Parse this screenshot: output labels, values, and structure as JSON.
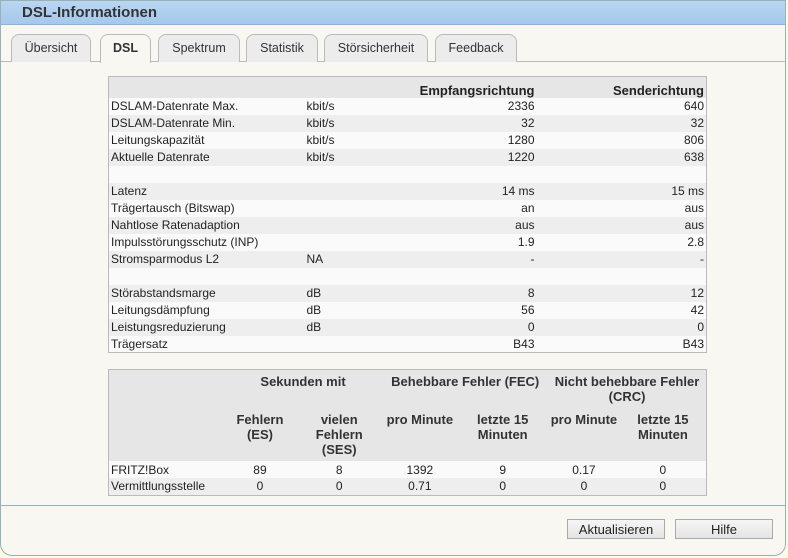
{
  "title": "DSL-Informationen",
  "tabs": [
    "Übersicht",
    "DSL",
    "Spektrum",
    "Statistik",
    "Störsicherheit",
    "Feedback"
  ],
  "info_table": {
    "headers": [
      "",
      "",
      "Empfangsrichtung",
      "Senderichtung"
    ],
    "rows": [
      [
        "DSLAM-Datenrate Max.",
        "kbit/s",
        "2336",
        "640"
      ],
      [
        "DSLAM-Datenrate Min.",
        "kbit/s",
        "32",
        "32"
      ],
      [
        "Leitungskapazität",
        "kbit/s",
        "1280",
        "806"
      ],
      [
        "Aktuelle Datenrate",
        "kbit/s",
        "1220",
        "638"
      ],
      [
        "",
        "",
        "",
        ""
      ],
      [
        "Latenz",
        "",
        "14 ms",
        "15 ms"
      ],
      [
        "Trägertausch (Bitswap)",
        "",
        "an",
        "aus"
      ],
      [
        "Nahtlose Ratenadaption",
        "",
        "aus",
        "aus"
      ],
      [
        "Impulsstörungsschutz (INP)",
        "",
        "1.9",
        "2.8"
      ],
      [
        "Stromsparmodus L2",
        "NA",
        "-",
        "-"
      ],
      [
        "",
        "",
        "",
        ""
      ],
      [
        "Störabstandsmarge",
        "dB",
        "8",
        "12"
      ],
      [
        "Leitungsdämpfung",
        "dB",
        "56",
        "42"
      ],
      [
        "Leistungsreduzierung",
        "dB",
        "0",
        "0"
      ],
      [
        "Trägersatz",
        "",
        "B43",
        "B43"
      ]
    ]
  },
  "error_table": {
    "groups": [
      "Sekunden mit",
      "Behebbare Fehler (FEC)",
      "Nicht behebbare Fehler (CRC)"
    ],
    "subheaders": [
      "Fehlern (ES)",
      "vielen Fehlern (SES)",
      "pro Minute",
      "letzte 15 Minuten",
      "pro Minute",
      "letzte 15 Minuten"
    ],
    "rows": [
      [
        "FRITZ!Box",
        "89",
        "8",
        "1392",
        "9",
        "0.17",
        "0"
      ],
      [
        "Vermittlungsstelle",
        "0",
        "0",
        "0.71",
        "0",
        "0",
        "0"
      ]
    ]
  },
  "buttons": {
    "refresh": "Aktualisieren",
    "help": "Hilfe"
  }
}
